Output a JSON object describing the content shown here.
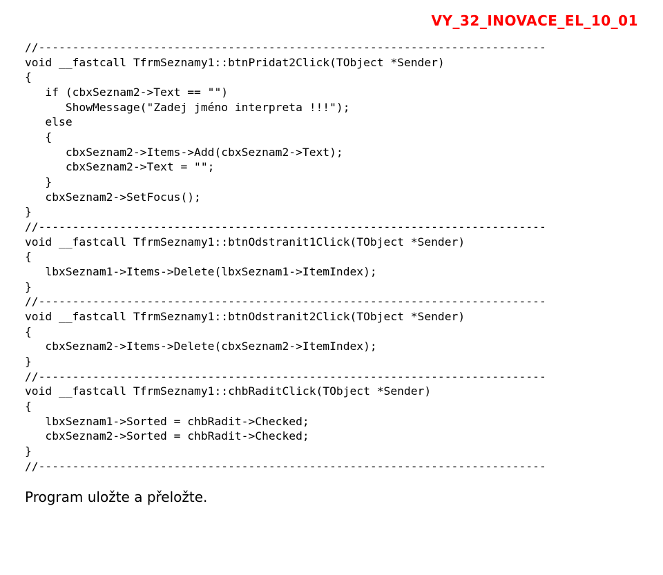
{
  "header": {
    "doc_id": "VY_32_INOVACE_EL_10_01"
  },
  "code": {
    "lines": [
      "//---------------------------------------------------------------------------",
      "void __fastcall TfrmSeznamy1::btnPridat2Click(TObject *Sender)",
      "{",
      "   if (cbxSeznam2->Text == \"\")",
      "      ShowMessage(\"Zadej jméno interpreta !!!\");",
      "   else",
      "   {",
      "      cbxSeznam2->Items->Add(cbxSeznam2->Text);",
      "      cbxSeznam2->Text = \"\";",
      "   }",
      "   cbxSeznam2->SetFocus();",
      "}",
      "//---------------------------------------------------------------------------",
      "void __fastcall TfrmSeznamy1::btnOdstranit1Click(TObject *Sender)",
      "{",
      "   lbxSeznam1->Items->Delete(lbxSeznam1->ItemIndex);",
      "}",
      "//---------------------------------------------------------------------------",
      "void __fastcall TfrmSeznamy1::btnOdstranit2Click(TObject *Sender)",
      "{",
      "   cbxSeznam2->Items->Delete(cbxSeznam2->ItemIndex);",
      "}",
      "//---------------------------------------------------------------------------",
      "void __fastcall TfrmSeznamy1::chbRaditClick(TObject *Sender)",
      "{",
      "   lbxSeznam1->Sorted = chbRadit->Checked;",
      "   cbxSeznam2->Sorted = chbRadit->Checked;",
      "}",
      "//---------------------------------------------------------------------------"
    ]
  },
  "footer": {
    "note": "Program uložte a přeložte."
  }
}
